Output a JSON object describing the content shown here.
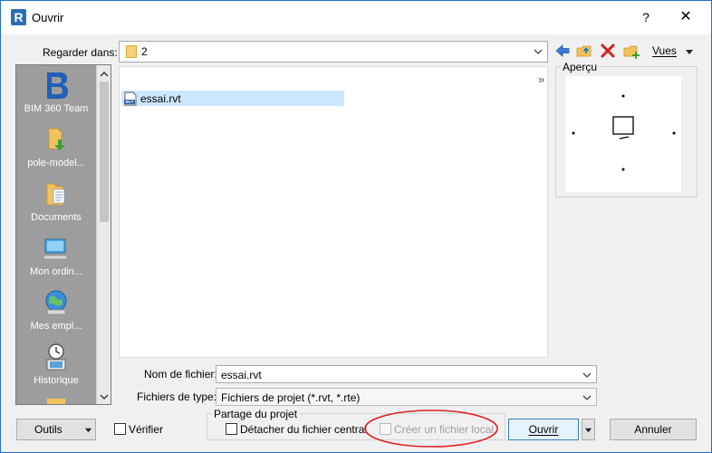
{
  "window": {
    "app_icon_letter": "R",
    "title": "Ouvrir",
    "help_glyph": "?",
    "close_glyph": "✕"
  },
  "lookin": {
    "label": "Regarder dans:",
    "value": "2"
  },
  "toolbar": {
    "back_icon": "back-arrow-icon",
    "up_folder_icon": "folder-up-icon",
    "delete_icon": "delete-icon",
    "new_folder_icon": "new-folder-icon",
    "views_label": "Vues"
  },
  "places": {
    "items": [
      {
        "label": "BIM 360 Team",
        "icon": "bim360-icon"
      },
      {
        "label": "pole-model...",
        "icon": "folder-link-icon"
      },
      {
        "label": "Documents",
        "icon": "documents-folder-icon"
      },
      {
        "label": "Mon ordin...",
        "icon": "computer-icon"
      },
      {
        "label": "Mes empl...",
        "icon": "network-globe-icon"
      },
      {
        "label": "Historique",
        "icon": "history-icon"
      }
    ]
  },
  "files": {
    "items": [
      {
        "name": "essai.rvt",
        "icon_text": "RVT"
      }
    ],
    "more_glyph": "»"
  },
  "preview": {
    "label": "Aperçu"
  },
  "filename": {
    "label": "Nom de fichier:",
    "value": "essai.rvt"
  },
  "filetype": {
    "label": "Fichiers de type:",
    "value": "Fichiers de projet  (*.rvt, *.rte)"
  },
  "bottom": {
    "tools_label": "Outils",
    "verify_label": "Vérifier",
    "sharing_group_label": "Partage du projet",
    "detach_label": "Détacher du fichier central",
    "create_local_label": "Créer un fichier local",
    "open_label": "Ouvrir",
    "cancel_label": "Annuler"
  },
  "colors": {
    "selection": "#cce8ff",
    "places_bg": "#9d9d9d",
    "annotation": "#e02020",
    "accent": "#2a6fb3"
  }
}
